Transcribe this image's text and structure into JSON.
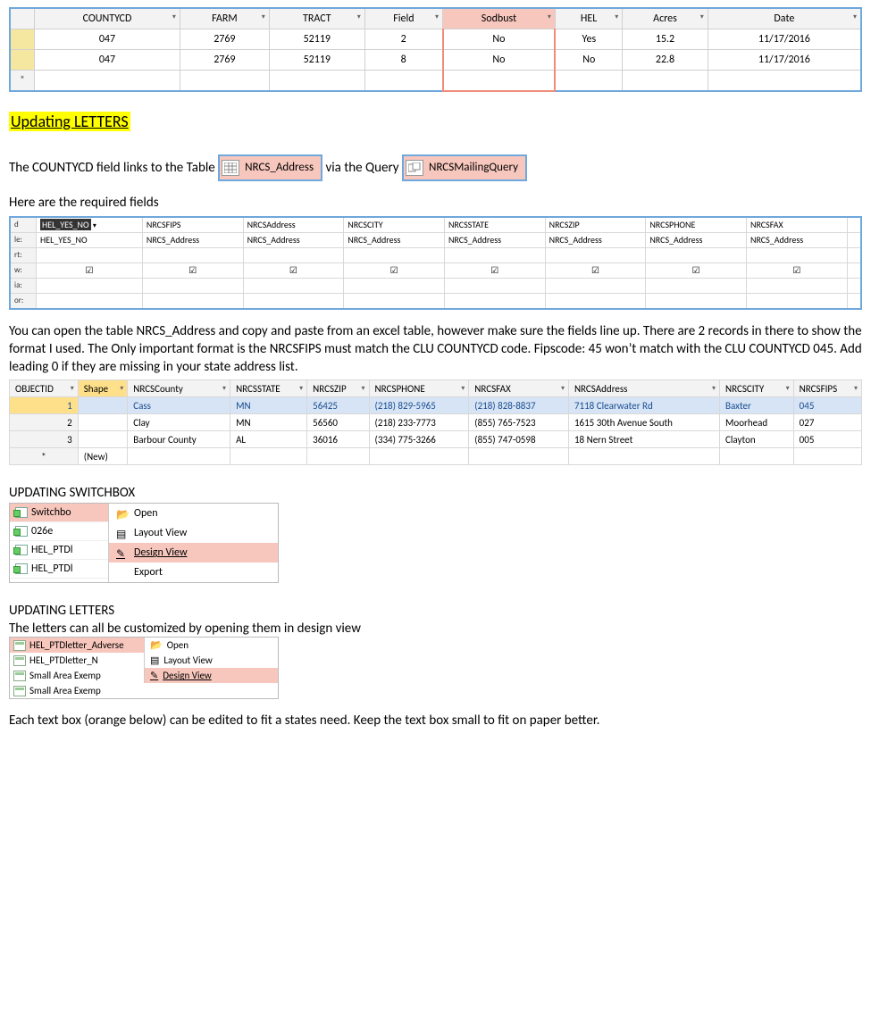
{
  "top_table": {
    "headers": [
      "COUNTYCD",
      "FARM",
      "TRACT",
      "Field",
      "Sodbust",
      "HEL",
      "Acres",
      "Date"
    ],
    "highlight_col": 4,
    "rows": [
      [
        "047",
        "2769",
        "52119",
        "2",
        "No",
        "Yes",
        "15.2",
        "11/17/2016"
      ],
      [
        "047",
        "2769",
        "52119",
        "8",
        "No",
        "No",
        "22.8",
        "11/17/2016"
      ]
    ],
    "new_marker": "*"
  },
  "heading_updating_letters": "Updating LETTERS",
  "linkline": {
    "pre": "The COUNTYCD field links to the Table ",
    "chip1": "NRCS_Address",
    "mid": " via the Query ",
    "chip2": "NRCSMailingQuery"
  },
  "req_fields_label": "Here are the required fields",
  "query_grid": {
    "side_labels_cut": [
      "d",
      "le:",
      "rt:",
      "w:",
      "ia:",
      "or:"
    ],
    "dropdown": "HEL_YES_NO",
    "row_table": [
      "HEL_YES_NO",
      "NRCS_Address",
      "NRCS_Address",
      "NRCS_Address",
      "NRCS_Address",
      "NRCS_Address",
      "NRCS_Address",
      "NRCS_Address"
    ],
    "row_field": [
      "",
      "NRCSFIPS",
      "NRCSAddress",
      "NRCSCITY",
      "NRCSSTATE",
      "NRCSZIP",
      "NRCSPHONE",
      "NRCSFAX"
    ]
  },
  "para_copy": "You can open the table NRCS_Address and copy and paste from an excel table, however make sure the fields line up.  There are 2 records in there to show the format I used. The Only important format is the NRCSFIPS must match the CLU COUNTYCD code. Fipscode: 45 won’t match with the CLU COUNTYCD 045. Add leading 0 if they are missing in your state address list.",
  "addr_table": {
    "headers": [
      "OBJECTID",
      "Shape",
      "NRCSCounty",
      "NRCSSTATE",
      "NRCSZIP",
      "NRCSPHONE",
      "NRCSFAX",
      "NRCSAddress",
      "NRCSCITY",
      "NRCSFIPS"
    ],
    "rows": [
      [
        "1",
        "",
        "Cass",
        "MN",
        "56425",
        "(218) 829-5965",
        "(218) 828-8837",
        "7118 Clearwater Rd",
        "Baxter",
        "045"
      ],
      [
        "2",
        "",
        "Clay",
        "MN",
        "56560",
        "(218) 233-7773",
        "(855) 765-7523",
        "1615 30th Avenue South",
        "Moorhead",
        "027"
      ],
      [
        "3",
        "",
        "Barbour County",
        "AL",
        "36016",
        "(334) 775-3266",
        "(855) 747-0598",
        "18 Nern Street",
        "Clayton",
        "005"
      ]
    ],
    "newrow": "(New)",
    "new_marker": "*"
  },
  "updating_switchbox": "UPDATING SWITCHBOX",
  "switchbox": {
    "nav": [
      "Switchbo",
      "026e",
      "HEL_PTDl",
      "HEL_PTDl"
    ],
    "menu": [
      "Open",
      "Layout View",
      "Design View",
      "Export"
    ],
    "selected_menu": 2
  },
  "updating_letters2": "UPDATING LETTERS",
  "letters_line": "The letters can all be customized by opening them in design view",
  "letters_ctx": {
    "nav": [
      "HEL_PTDletter_Adverse",
      "HEL_PTDletter_N",
      "Small Area Exemp",
      "Small Area Exemp"
    ],
    "menu": [
      "Open",
      "Layout View",
      "Design View"
    ],
    "selected_menu": 2
  },
  "closing": "Each text box (orange below) can be edited to fit a states need. Keep the text box small to fit on paper better."
}
